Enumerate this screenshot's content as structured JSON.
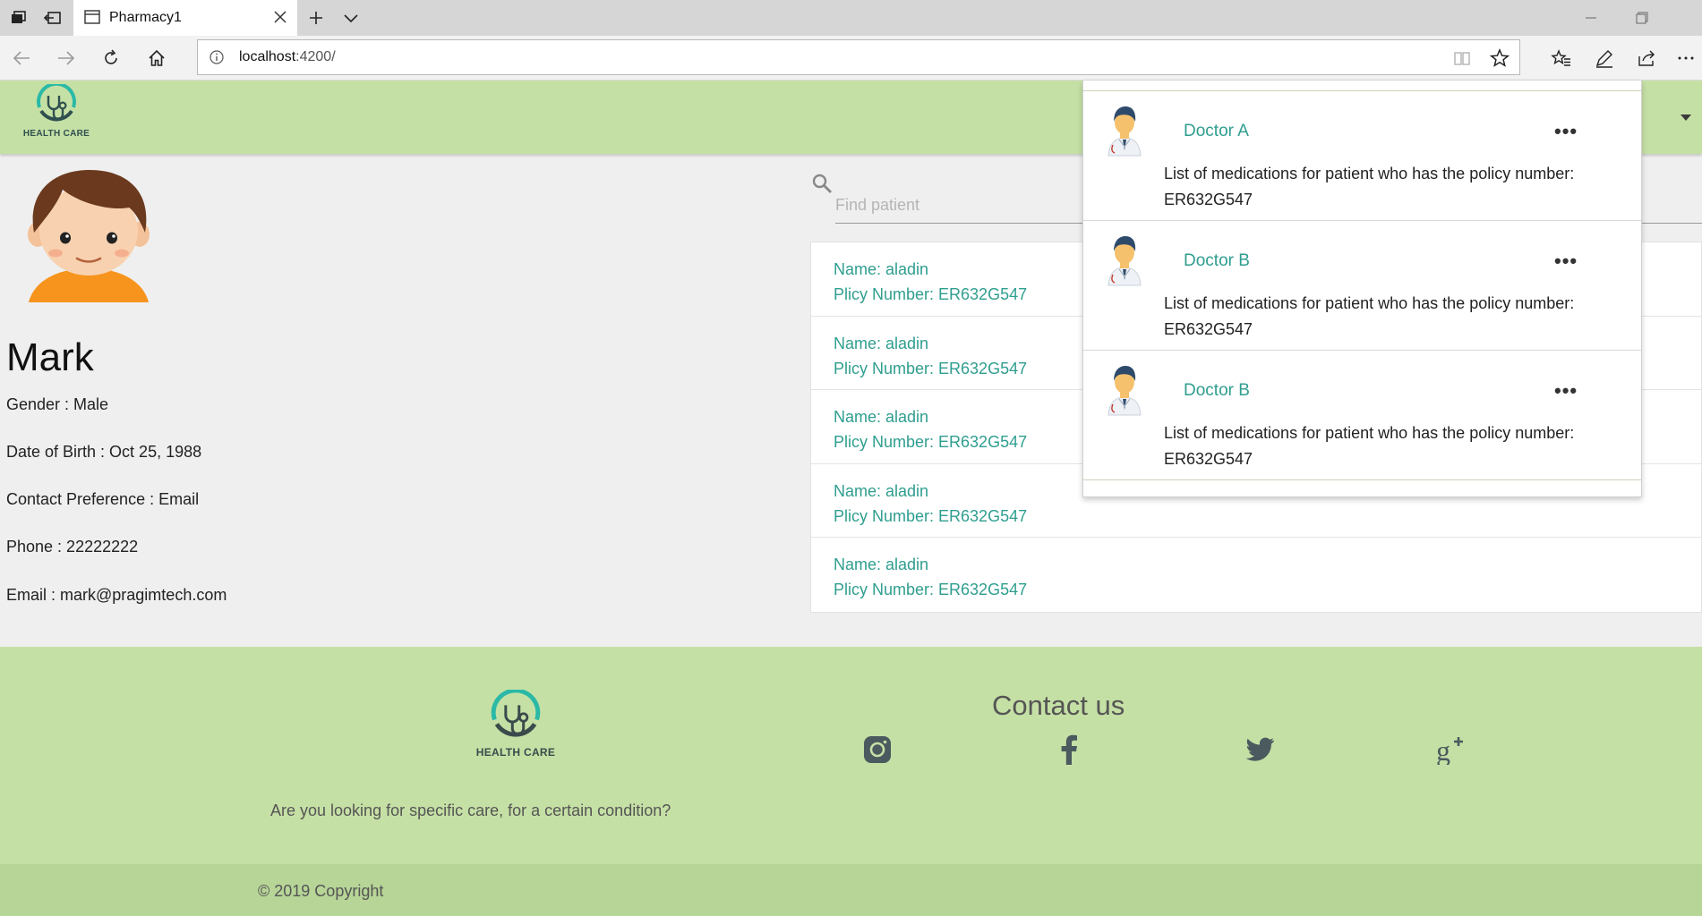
{
  "browser": {
    "tab_title": "Pharmacy1",
    "url_host": "localhost",
    "url_port": ":4200/",
    "icons": [
      "task-view-icon",
      "back-tabs-icon",
      "tab-page-icon",
      "close-icon",
      "new-tab-icon",
      "tab-list-chevron-icon",
      "minimize-icon",
      "restore-icon",
      "back-icon",
      "forward-icon",
      "refresh-icon",
      "home-icon",
      "info-icon",
      "reading-view-icon",
      "favorite-star-icon",
      "favorites-hub-icon",
      "pen-icon",
      "share-icon",
      "more-icon"
    ]
  },
  "header": {
    "logo_text": "HEALTH CARE",
    "colors": {
      "header_bg": "#c5e0a5",
      "accent": "#2f9e8f"
    }
  },
  "profile": {
    "name": "Mark",
    "details": [
      "Gender : Male",
      "Date of Birth : Oct 25, 1988",
      "Contact Preference : Email",
      "Phone : 22222222",
      "Email : mark@pragimtech.com"
    ]
  },
  "search": {
    "placeholder": "Find patient",
    "value": ""
  },
  "patients": [
    {
      "name": "Name: aladin",
      "policy": "Plicy Number: ER632G547"
    },
    {
      "name": "Name: aladin",
      "policy": "Plicy Number: ER632G547"
    },
    {
      "name": "Name: aladin",
      "policy": "Plicy Number: ER632G547"
    },
    {
      "name": "Name: aladin",
      "policy": "Plicy Number: ER632G547"
    },
    {
      "name": "Name: aladin",
      "policy": "Plicy Number: ER632G547"
    }
  ],
  "doctors": [
    {
      "name": "Doctor A",
      "more": "•••",
      "text": "List of medications for patient who has the policy number: ER632G547"
    },
    {
      "name": "Doctor B",
      "more": "•••",
      "text": "List of medications for patient who has the policy number: ER632G547"
    },
    {
      "name": "Doctor B",
      "more": "•••",
      "text": "List of medications for patient who has the policy number: ER632G547"
    }
  ],
  "footer": {
    "logo_text": "HEALTH CARE",
    "question": "Are you looking for specific care, for a certain condition?",
    "contact_title": "Contact us",
    "social_icons": [
      "instagram-icon",
      "facebook-icon",
      "twitter-icon",
      "google-plus-icon"
    ],
    "copyright": "© 2019 Copyright"
  }
}
